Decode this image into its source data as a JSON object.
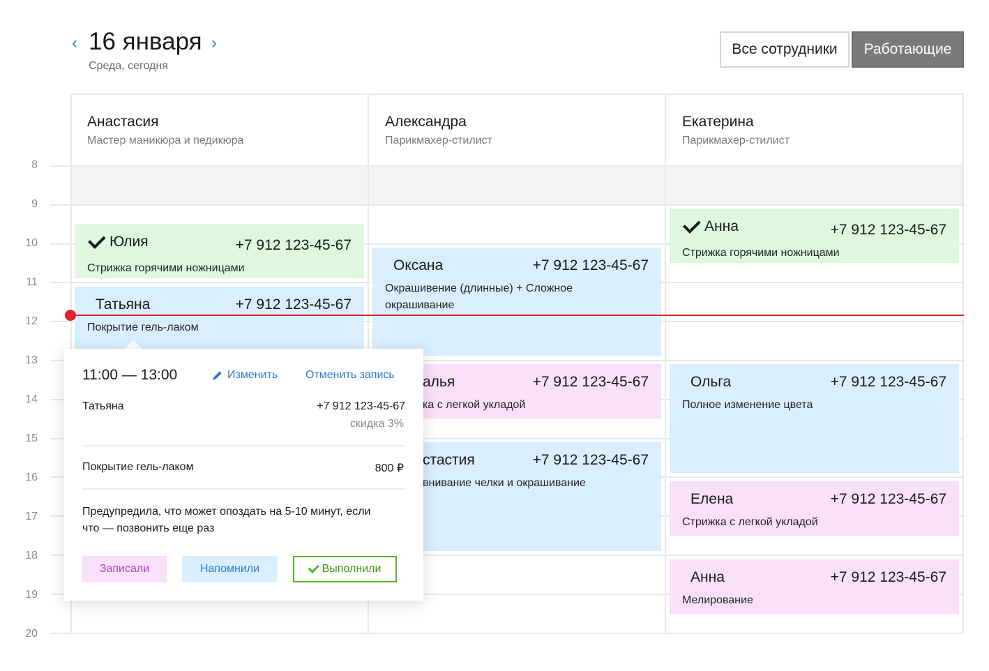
{
  "header": {
    "date": "16 января",
    "subtitle": "Среда, сегодня",
    "prev_arrow": "‹",
    "next_arrow": "›",
    "filters": {
      "all": "Все сотрудники",
      "working": "Работающие",
      "active": "working"
    }
  },
  "hours": [
    "8",
    "9",
    "10",
    "11",
    "12",
    "13",
    "14",
    "15",
    "16",
    "17",
    "18",
    "19",
    "20"
  ],
  "employees": [
    {
      "name": "Анастасия",
      "role": "Мастер маникюра и педикюра"
    },
    {
      "name": "Александра",
      "role": "Парикмахер-стилист"
    },
    {
      "name": "Екатерина",
      "role": "Парикмахер-стилист"
    }
  ],
  "appointments": {
    "c1": [
      {
        "name": "Юлия",
        "phone": "+7 912 123-45-67",
        "service": "Стрижка горячими ножницами",
        "color": "green",
        "confirmed": true
      },
      {
        "name": "Татьяна",
        "phone": "+7 912 123-45-67",
        "service": "Покрытие гель-лаком",
        "color": "blue"
      }
    ],
    "c2": [
      {
        "name": "Оксана",
        "phone": "+7 912 123-45-67",
        "service": "Окрашивение (длинные) + Сложное окрашивание",
        "color": "blue"
      },
      {
        "name": "алья",
        "phone": "+7 912 123-45-67",
        "service": "ка с легкой укладой",
        "color": "pink"
      },
      {
        "name": "стастия",
        "phone": "+7 912 123-45-67",
        "service": "внивание челки и окрашивание",
        "color": "blue"
      }
    ],
    "c3": [
      {
        "name": "Анна",
        "phone": "+7 912 123-45-67",
        "service": "Стрижка горячими ножницами",
        "color": "green",
        "confirmed": true
      },
      {
        "name": "Ольга",
        "phone": "+7 912 123-45-67",
        "service": "Полное изменение цвета",
        "color": "blue"
      },
      {
        "name": "Елена",
        "phone": "+7 912 123-45-67",
        "service": "Стрижка с легкой укладой",
        "color": "pink"
      },
      {
        "name": "Анна",
        "phone": "+7 912 123-45-67",
        "service": "Мелирование",
        "color": "pink"
      }
    ]
  },
  "popup": {
    "time": "11:00 — 13:00",
    "edit": "Изменить",
    "cancel": "Отменить запись",
    "client": "Татьяна",
    "phone": "+7 912 123-45-67",
    "discount": "скидка 3%",
    "service": "Покрытие гель-лаком",
    "price": "800 ₽",
    "note": "Предупредила, что может опоздать на 5-10 минут, если что — позвонить еще раз",
    "statuses": {
      "booked": "Записали",
      "reminded": "Напомнили",
      "done": "Выполнили"
    }
  },
  "colors": {
    "accent": "#2b7bd3",
    "now_line": "#e0242a",
    "green": "#dff7df",
    "blue": "#d9efff",
    "pink": "#f9e0fb",
    "done": "#52b828"
  }
}
